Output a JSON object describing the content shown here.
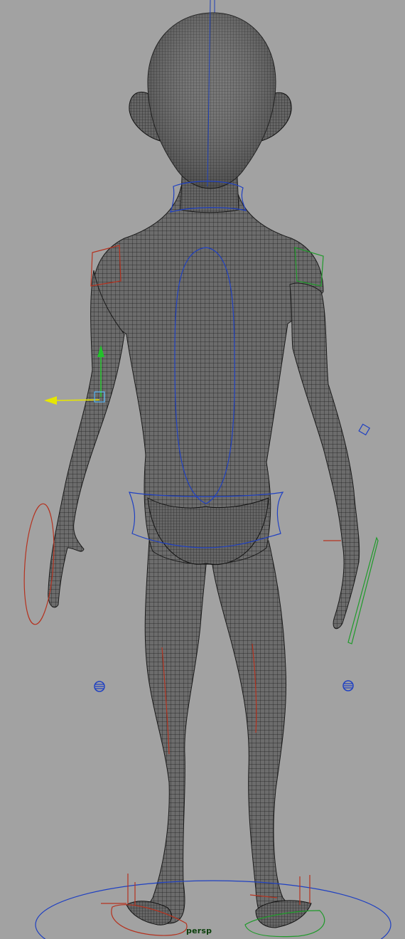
{
  "viewport": {
    "camera_name": "persp",
    "background_color": "#a2a2a2",
    "mesh_fill": "#6b6b6b",
    "mesh_wire": "#141414",
    "axis_line_color": "#1e3fb4",
    "control_blue": "#1f40c2",
    "control_red": "#b5321f",
    "control_green": "#1f9a2a",
    "manipulator_yellow": "#e6e600",
    "manipulator_green": "#22c22a"
  },
  "scene_objects": [
    {
      "name": "character-mesh",
      "type": "polygon-mesh",
      "view": "back"
    },
    {
      "name": "neck-control",
      "color": "blue"
    },
    {
      "name": "spine-control",
      "color": "blue"
    },
    {
      "name": "hips-control",
      "color": "blue"
    },
    {
      "name": "left-shoulder-control",
      "color": "red"
    },
    {
      "name": "right-shoulder-control",
      "color": "green"
    },
    {
      "name": "left-wrist-control",
      "color": "red"
    },
    {
      "name": "right-wrist-control",
      "color": "green"
    },
    {
      "name": "left-pole-vector",
      "color": "blue"
    },
    {
      "name": "right-pole-vector",
      "color": "blue"
    },
    {
      "name": "root-control",
      "color": "blue"
    },
    {
      "name": "left-foot-control",
      "color": "red"
    },
    {
      "name": "right-foot-control",
      "color": "green"
    },
    {
      "name": "move-manipulator",
      "color": "yellow"
    }
  ]
}
